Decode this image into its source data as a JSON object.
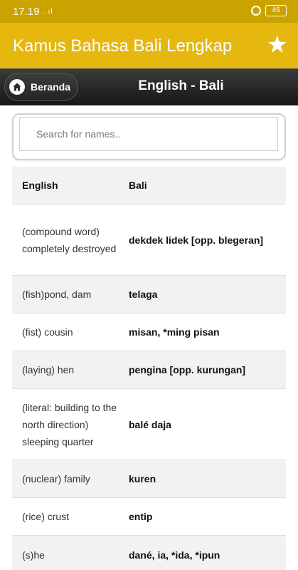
{
  "status_bar": {
    "time": "17.19",
    "signal": "..ıl",
    "battery": "46"
  },
  "app_bar": {
    "title": "Kamus Bahasa Bali Lengkap",
    "favorite_icon": "star-icon"
  },
  "nav": {
    "home_label": "Beranda",
    "home_icon": "home-icon",
    "page_title": "English - Bali"
  },
  "search": {
    "placeholder": "Search for names.."
  },
  "table": {
    "headers": {
      "english": "English",
      "bali": "Bali"
    },
    "rows": [
      {
        "english": "(compound word) completely destroyed",
        "bali": "dekdek lidek [opp. blegeran]"
      },
      {
        "english": "(fish)pond, dam",
        "bali": "telaga"
      },
      {
        "english": "(fist) cousin",
        "bali": "misan, *ming pisan"
      },
      {
        "english": "(laying) hen",
        "bali": "pengina [opp. kurungan]"
      },
      {
        "english": "(literal: building to the north direction) sleeping quarter",
        "bali": "balé daja"
      },
      {
        "english": "(nuclear) family",
        "bali": "kuren"
      },
      {
        "english": "(rice) crust",
        "bali": "entip"
      },
      {
        "english": "(s)he",
        "bali": "dané, ia, *ida, *ipun"
      }
    ]
  },
  "colors": {
    "status_bar": "#c9a300",
    "app_bar": "#e5b70f",
    "nav_bar": "#222222"
  }
}
